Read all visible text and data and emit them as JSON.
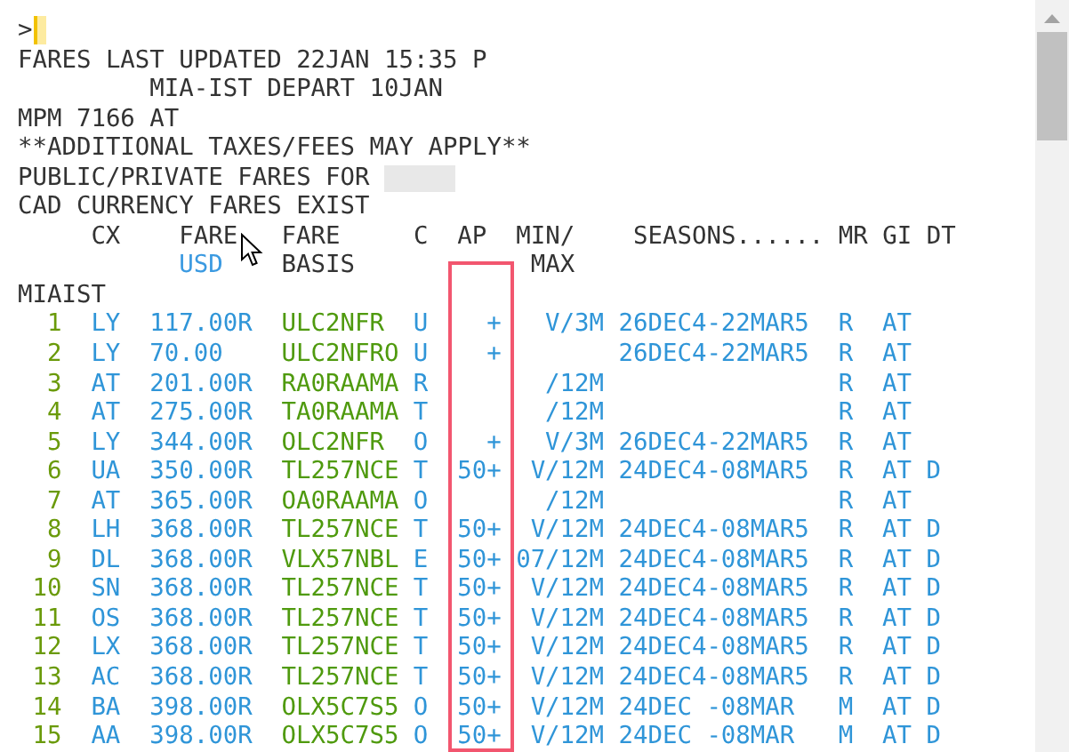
{
  "prompt": ">",
  "info_lines": [
    {
      "text": "FARES LAST UPDATED 22JAN 15:35 P",
      "redacted": false
    },
    {
      "text": "         MIA-IST DEPART 10JAN",
      "redacted": false
    },
    {
      "text": "MPM 7166 AT",
      "redacted": false
    },
    {
      "text": "**ADDITIONAL TAXES/FEES MAY APPLY**",
      "redacted": false
    },
    {
      "text": "PUBLIC/PRIVATE FARES FOR ",
      "redacted": true
    },
    {
      "text": "CAD CURRENCY FARES EXIST",
      "redacted": false
    }
  ],
  "columns": [
    {
      "top": "CX"
    },
    {
      "top": "FARE",
      "bottom": "USD",
      "accent": true
    },
    {
      "top": "FARE",
      "bottom": "BASIS"
    },
    {
      "top": "C"
    },
    {
      "top": "AP",
      "highlighted": true
    },
    {
      "top": "MIN/",
      "bottom": "MAX"
    },
    {
      "top": "SEASONS......"
    },
    {
      "top": "MR"
    },
    {
      "top": "GI"
    },
    {
      "top": "DT"
    }
  ],
  "city_pair": "MIAIST",
  "rows": [
    {
      "num": "1",
      "cx": "LY",
      "fare": "117.00R",
      "basis": "ULC2NFR",
      "c": "U",
      "ap": "+",
      "min": "V/3M",
      "seasons": "26DEC4-22MAR5",
      "mr": "R",
      "gi": "AT"
    },
    {
      "num": "2",
      "cx": "LY",
      "fare": "70.00",
      "basis": "ULC2NFRO",
      "c": "U",
      "ap": "+",
      "seasons": "26DEC4-22MAR5",
      "mr": "R",
      "gi": "AT"
    },
    {
      "num": "3",
      "cx": "AT",
      "fare": "201.00R",
      "basis": "RA0RAAMA",
      "c": "R",
      "min": "/12M",
      "mr": "R",
      "gi": "AT"
    },
    {
      "num": "4",
      "cx": "AT",
      "fare": "275.00R",
      "basis": "TA0RAAMA",
      "c": "T",
      "min": "/12M",
      "mr": "R",
      "gi": "AT"
    },
    {
      "num": "5",
      "cx": "LY",
      "fare": "344.00R",
      "basis": "OLC2NFR",
      "c": "O",
      "ap": "+",
      "min": "V/3M",
      "seasons": "26DEC4-22MAR5",
      "mr": "R",
      "gi": "AT"
    },
    {
      "num": "6",
      "cx": "UA",
      "fare": "350.00R",
      "basis": "TL257NCE",
      "c": "T",
      "ap": "50+",
      "min": "V/12M",
      "seasons": "24DEC4-08MAR5",
      "mr": "R",
      "gi": "AT",
      "dt": "D"
    },
    {
      "num": "7",
      "cx": "AT",
      "fare": "365.00R",
      "basis": "OA0RAAMA",
      "c": "O",
      "min": "/12M",
      "mr": "R",
      "gi": "AT"
    },
    {
      "num": "8",
      "cx": "LH",
      "fare": "368.00R",
      "basis": "TL257NCE",
      "c": "T",
      "ap": "50+",
      "min": "V/12M",
      "seasons": "24DEC4-08MAR5",
      "mr": "R",
      "gi": "AT",
      "dt": "D"
    },
    {
      "num": "9",
      "cx": "DL",
      "fare": "368.00R",
      "basis": "VLX57NBL",
      "c": "E",
      "ap": "50+",
      "min": "07/12M",
      "seasons": "24DEC4-08MAR5",
      "mr": "R",
      "gi": "AT",
      "dt": "D"
    },
    {
      "num": "10",
      "cx": "SN",
      "fare": "368.00R",
      "basis": "TL257NCE",
      "c": "T",
      "ap": "50+",
      "min": "V/12M",
      "seasons": "24DEC4-08MAR5",
      "mr": "R",
      "gi": "AT",
      "dt": "D"
    },
    {
      "num": "11",
      "cx": "OS",
      "fare": "368.00R",
      "basis": "TL257NCE",
      "c": "T",
      "ap": "50+",
      "min": "V/12M",
      "seasons": "24DEC4-08MAR5",
      "mr": "R",
      "gi": "AT",
      "dt": "D"
    },
    {
      "num": "12",
      "cx": "LX",
      "fare": "368.00R",
      "basis": "TL257NCE",
      "c": "T",
      "ap": "50+",
      "min": "V/12M",
      "seasons": "24DEC4-08MAR5",
      "mr": "R",
      "gi": "AT",
      "dt": "D"
    },
    {
      "num": "13",
      "cx": "AC",
      "fare": "368.00R",
      "basis": "TL257NCE",
      "c": "T",
      "ap": "50+",
      "min": "V/12M",
      "seasons": "24DEC4-08MAR5",
      "mr": "R",
      "gi": "AT",
      "dt": "D"
    },
    {
      "num": "14",
      "cx": "BA",
      "fare": "398.00R",
      "basis": "OLX5C7S5",
      "c": "O",
      "ap": "50+",
      "min": "V/12M",
      "seasons": "24DEC -08MAR",
      "mr": "M",
      "gi": "AT",
      "dt": "D"
    },
    {
      "num": "15",
      "cx": "AA",
      "fare": "398.00R",
      "basis": "OLX5C7S5",
      "c": "O",
      "ap": "50+",
      "min": "V/12M",
      "seasons": "24DEC -08MAR",
      "mr": "M",
      "gi": "AT",
      "dt": "D"
    }
  ]
}
